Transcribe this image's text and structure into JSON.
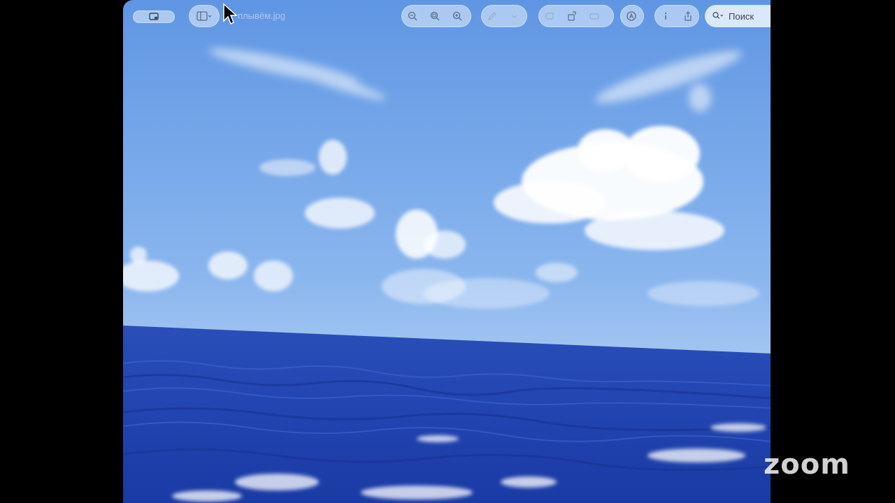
{
  "window": {
    "file_title": "плывём.jpg"
  },
  "toolbar": {
    "sidebar_toggle_icon": "sidebar-icon",
    "zoom_out_icon": "zoom-out-icon",
    "actual_size_icon": "zoom-fit-icon",
    "zoom_in_icon": "zoom-in-icon",
    "markup_icon": "pen-icon",
    "crop_icon": "crop-icon",
    "rotate_icon": "rotate-icon",
    "resize_icon": "resize-icon",
    "annotate_icon": "markup-circle-icon",
    "info_icon": "info-icon",
    "share_icon": "share-icon",
    "search_placeholder": "Поиск"
  },
  "overlay": {
    "brand": "zoom"
  },
  "colors": {
    "sky_top": "#5f96e3",
    "sky_horizon": "#cfe2f6",
    "sea_top": "#2a4fb8",
    "sea_bottom": "#1a3aa4",
    "toolbar_pill": "#e8f2ff"
  }
}
